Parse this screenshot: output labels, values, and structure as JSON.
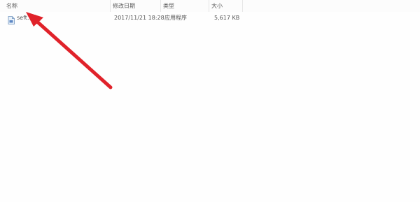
{
  "columns": {
    "name": "名称",
    "modified": "修改日期",
    "type": "类型",
    "size": "大小"
  },
  "files": [
    {
      "name": "seft…ck",
      "modified": "2017/11/21 18:28",
      "type": "应用程序",
      "size": "5,617 KB"
    }
  ],
  "colors": {
    "arrow": "#e0242b"
  },
  "icons": {
    "file": "application-file-icon"
  }
}
